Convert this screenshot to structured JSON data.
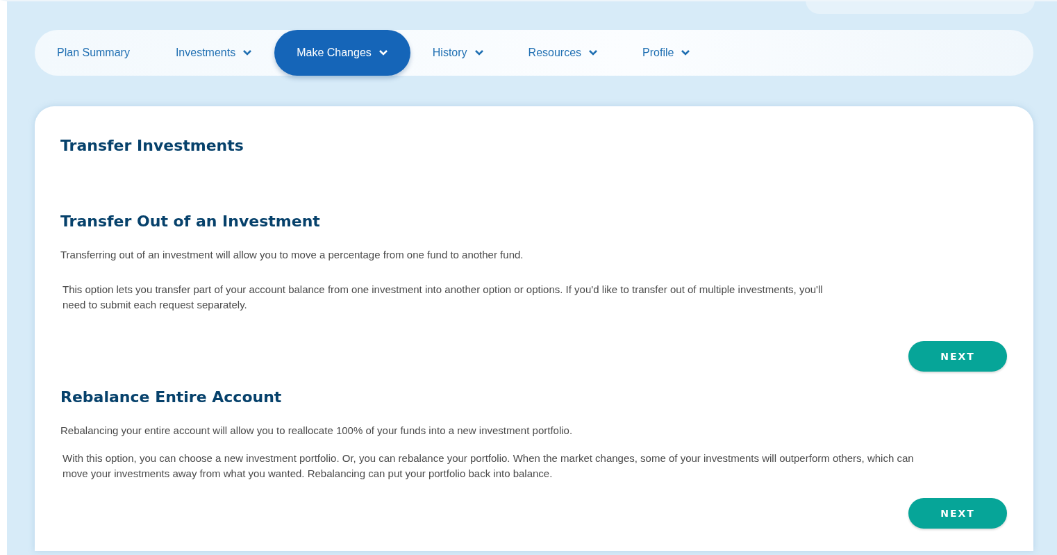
{
  "nav": {
    "tabs": [
      {
        "label": "Plan Summary",
        "selected": false,
        "has_menu": false
      },
      {
        "label": "Investments",
        "selected": false,
        "has_menu": true
      },
      {
        "label": "Make Changes",
        "selected": true,
        "has_menu": true
      },
      {
        "label": "History",
        "selected": false,
        "has_menu": true
      },
      {
        "label": "Resources",
        "selected": false,
        "has_menu": true
      },
      {
        "label": "Profile",
        "selected": false,
        "has_menu": true
      }
    ]
  },
  "page": {
    "title": "Transfer Investments",
    "sections": [
      {
        "title": "Transfer Out of an Investment",
        "summary": "Transferring out of an investment will allow you to move a percentage from one fund to another fund.",
        "detail": "This option lets you transfer part of your account balance from one investment into another option or options. If you'd like to transfer out of multiple investments, you'll need to submit each request separately.",
        "button": "NEXT"
      },
      {
        "title": "Rebalance Entire Account",
        "summary": "Rebalancing your entire account will allow you to reallocate 100% of your funds into a new investment portfolio.",
        "detail": "With this option, you can choose a new investment portfolio. Or, you can rebalance your portfolio. When the market changes, some of your investments will outperform others, which can move your investments away from what you wanted. Rebalancing can put your portfolio back into balance.",
        "button": "NEXT"
      }
    ]
  }
}
